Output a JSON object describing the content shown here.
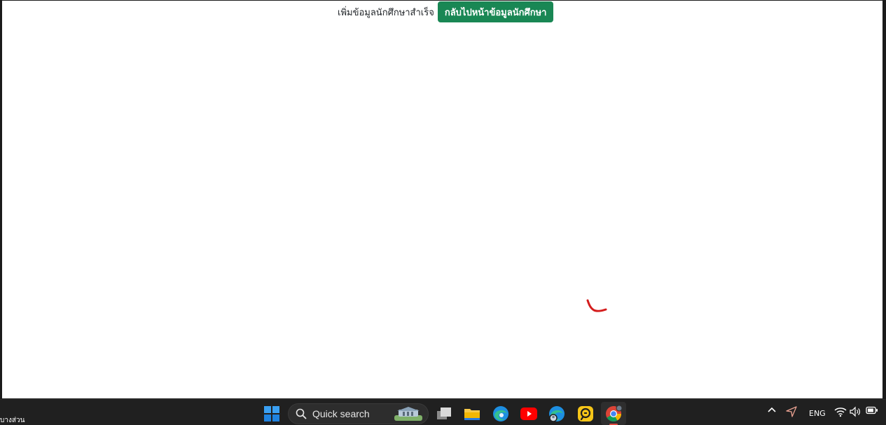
{
  "page": {
    "success_message": "เพิ่มข้อมูลนักศึกษาสำเร็จ",
    "back_button_label": "กลับไปหน้าข้อมูลนักศึกษา",
    "button_color": "#198754"
  },
  "taskbar": {
    "corner_label": "บางส่วน",
    "search": {
      "label": "Quick search"
    },
    "apps": [
      {
        "name": "start-icon"
      },
      {
        "name": "task-view-icon"
      },
      {
        "name": "file-explorer-icon"
      },
      {
        "name": "edge-icon"
      },
      {
        "name": "youtube-icon"
      },
      {
        "name": "edge-profile-icon"
      },
      {
        "name": "app-yellow-icon"
      },
      {
        "name": "chrome-icon",
        "active": true
      }
    ],
    "tray": {
      "language": "ENG",
      "icons": [
        "chevron-up-icon",
        "location-icon",
        "wifi-icon",
        "volume-icon",
        "battery-icon"
      ]
    }
  }
}
